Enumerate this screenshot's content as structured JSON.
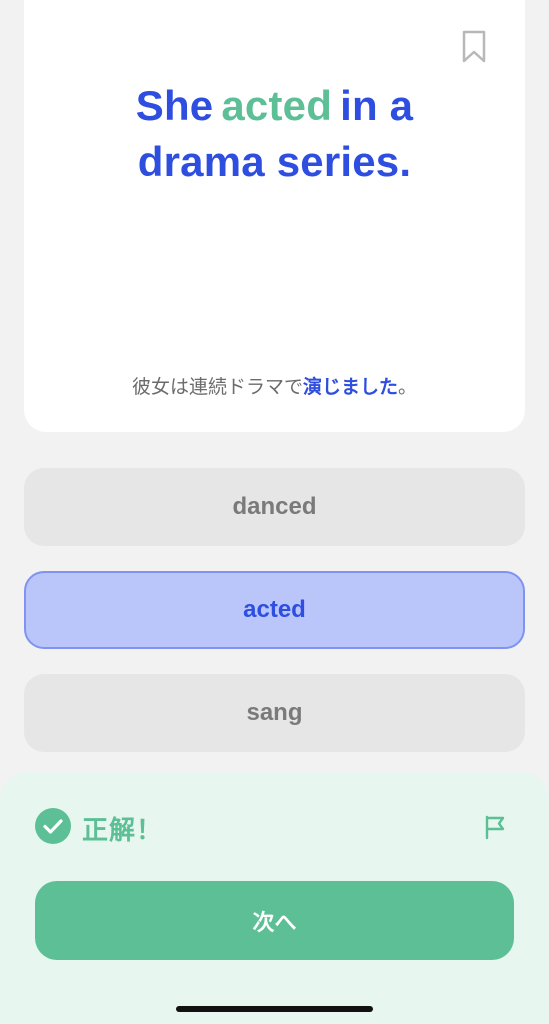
{
  "card": {
    "sentence": {
      "w1": "She",
      "w2": "acted",
      "w3": "in a",
      "w4": "drama series."
    },
    "translation": {
      "part1": "彼女は連続ドラマで",
      "highlight": "演じました",
      "part2": "。"
    },
    "bookmark_icon": "bookmark-icon"
  },
  "options": [
    {
      "label": "danced",
      "state": "default"
    },
    {
      "label": "acted",
      "state": "selected"
    },
    {
      "label": "sang",
      "state": "default"
    }
  ],
  "feedback": {
    "result": "正解！",
    "status_icon": "check-circle-icon",
    "report_icon": "flag-icon",
    "next_label": "次へ"
  },
  "colors": {
    "accent_blue": "#2e4ee0",
    "accent_green": "#5dbf96",
    "selected_bg": "#bac6fa",
    "feedback_bg": "#e7f6ef"
  }
}
